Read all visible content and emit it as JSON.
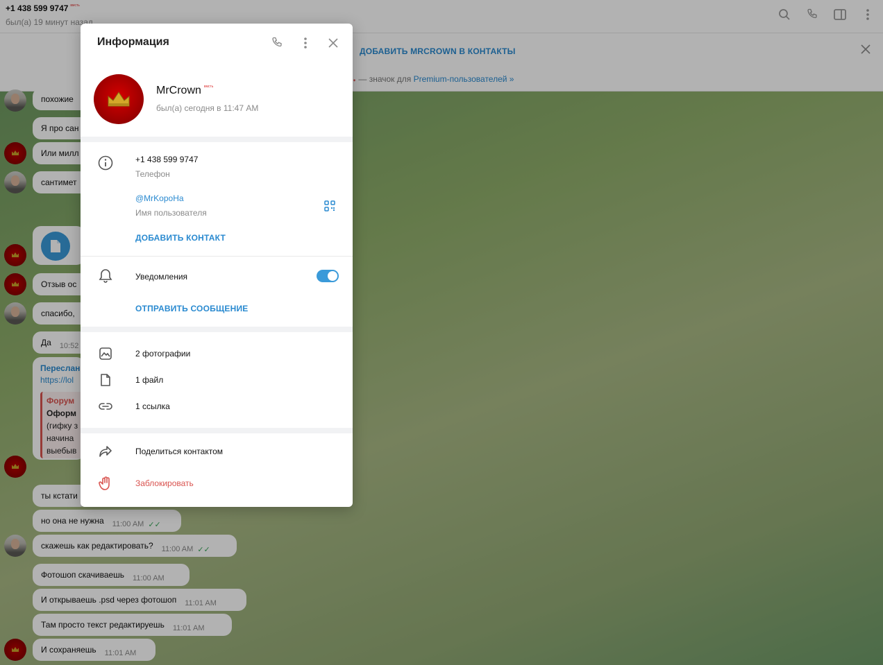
{
  "topbar": {
    "name": "+1 438 599 9747",
    "name_tag": "вмсть",
    "status": "был(а) 19 минут назад",
    "icons": [
      "search-icon",
      "phone-icon",
      "sidebar-icon",
      "more-vertical-icon"
    ]
  },
  "banner": {
    "add_contact": "ДОБАВИТЬ MRCROWN В КОНТАКТЫ",
    "premium_prefix": " — значок для ",
    "premium_link": "Premium-пользователей »"
  },
  "chat": {
    "messages": [
      {
        "text": "похожие",
        "time": ""
      },
      {
        "text": "Я про сан",
        "time": ""
      },
      {
        "text": "Или милл",
        "time": ""
      },
      {
        "text": "сантимет",
        "time": ""
      },
      {
        "text": "Отзыв ос",
        "time": ""
      },
      {
        "text": "спасибо,",
        "time": ""
      },
      {
        "text": "Да",
        "time": "10:52"
      },
      {
        "text": "ты кстати",
        "time": ""
      },
      {
        "text": "но она не нужна",
        "time": "11:00 AM"
      },
      {
        "text": "скажешь как редактировать?",
        "time": "11:00 AM"
      },
      {
        "text": "Фотошоп скачиваешь",
        "time": "11:00 AM"
      },
      {
        "text": "И открываешь .psd через фотошоп",
        "time": "11:01 AM"
      },
      {
        "text": "Там просто текст редактируешь",
        "time": "11:01 AM"
      },
      {
        "text": "И сохраняешь",
        "time": "11:01 AM"
      }
    ],
    "forward": {
      "header": "Переслан",
      "link": "https://lol",
      "quote_title": "Форум",
      "quote_bold": "Оформ",
      "quote_lines": [
        "(гифку з",
        "начина",
        "выебыв"
      ]
    }
  },
  "dialog": {
    "title": "Информация",
    "profile": {
      "name": "MrCrown",
      "name_tag": "вмсть",
      "status": "был(а) сегодня в 11:47 AM"
    },
    "info": {
      "phone": "+1 438 599 9747",
      "phone_label": "Телефон",
      "username": "@MrKopoHa",
      "username_label": "Имя пользователя",
      "add_contact": "ДОБАВИТЬ КОНТАКТ"
    },
    "notifications": {
      "label": "Уведомления",
      "enabled": true,
      "send_message": "ОТПРАВИТЬ СООБЩЕНИЕ"
    },
    "media": {
      "photos": "2 фотографии",
      "files": "1 файл",
      "links": "1 ссылка"
    },
    "actions": {
      "share": "Поделиться контактом",
      "block": "Заблокировать"
    },
    "colors": {
      "accent": "#2a8ad0",
      "danger": "#d9534f",
      "toggle": "#3a9ad9"
    }
  }
}
